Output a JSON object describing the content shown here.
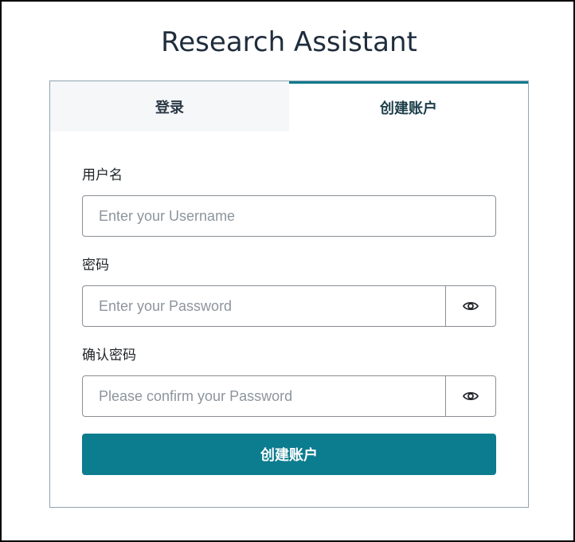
{
  "app": {
    "title": "Research Assistant"
  },
  "tabs": [
    {
      "label": "登录",
      "active": false
    },
    {
      "label": "创建账户",
      "active": true
    }
  ],
  "form": {
    "username": {
      "label": "用户名",
      "placeholder": "Enter your Username",
      "value": ""
    },
    "password": {
      "label": "密码",
      "placeholder": "Enter your Password",
      "value": "",
      "toggle_icon": "eye-icon"
    },
    "confirm_password": {
      "label": "确认密码",
      "placeholder": "Please confirm your Password",
      "value": "",
      "toggle_icon": "eye-icon"
    },
    "submit_label": "创建账户"
  },
  "colors": {
    "accent": "#0c7c8f",
    "active_tab_border": "#0f7a8c",
    "inactive_tab_bg": "#f6f7f8"
  }
}
